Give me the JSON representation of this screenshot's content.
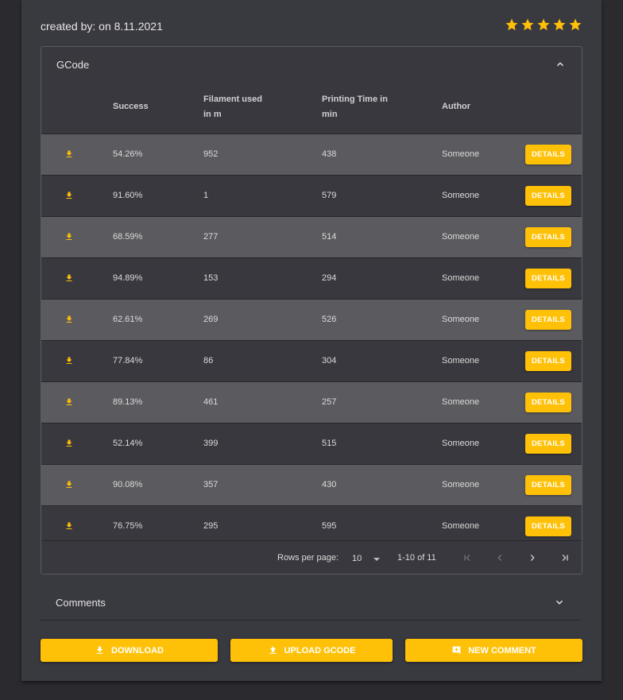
{
  "header": {
    "created_text": "created by: on 8.11.2021"
  },
  "rating": {
    "value": 5,
    "max": 5,
    "color": "#ffc107"
  },
  "gcode_panel": {
    "title": "GCode",
    "columns": {
      "success": "Success",
      "filament_line1": "Filament used",
      "filament_line2": "in m",
      "time_line1": "Printing Time in",
      "time_line2": "min",
      "author": "Author"
    },
    "details_label": "DETAILS",
    "rows": [
      {
        "success": "54.26%",
        "filament": "952",
        "time": "438",
        "author": "Someone"
      },
      {
        "success": "91.60%",
        "filament": "1",
        "time": "579",
        "author": "Someone"
      },
      {
        "success": "68.59%",
        "filament": "277",
        "time": "514",
        "author": "Someone"
      },
      {
        "success": "94.89%",
        "filament": "153",
        "time": "294",
        "author": "Someone"
      },
      {
        "success": "62.61%",
        "filament": "269",
        "time": "526",
        "author": "Someone"
      },
      {
        "success": "77.84%",
        "filament": "86",
        "time": "304",
        "author": "Someone"
      },
      {
        "success": "89.13%",
        "filament": "461",
        "time": "257",
        "author": "Someone"
      },
      {
        "success": "52.14%",
        "filament": "399",
        "time": "515",
        "author": "Someone"
      },
      {
        "success": "90.08%",
        "filament": "357",
        "time": "430",
        "author": "Someone"
      },
      {
        "success": "76.75%",
        "filament": "295",
        "time": "595",
        "author": "Someone"
      }
    ],
    "pagination": {
      "rows_per_page_label": "Rows per page:",
      "rows_per_page_value": "10",
      "range_text": "1-10 of 11"
    }
  },
  "comments_panel": {
    "title": "Comments"
  },
  "actions": {
    "download_label": "DOWNLOAD",
    "upload_label": "UPLOAD GCODE",
    "new_comment_label": "NEW COMMENT"
  },
  "colors": {
    "accent": "#ffc107",
    "row_alt": "#5a5a5f",
    "card": "#393940",
    "page": "#2a2a2f"
  }
}
